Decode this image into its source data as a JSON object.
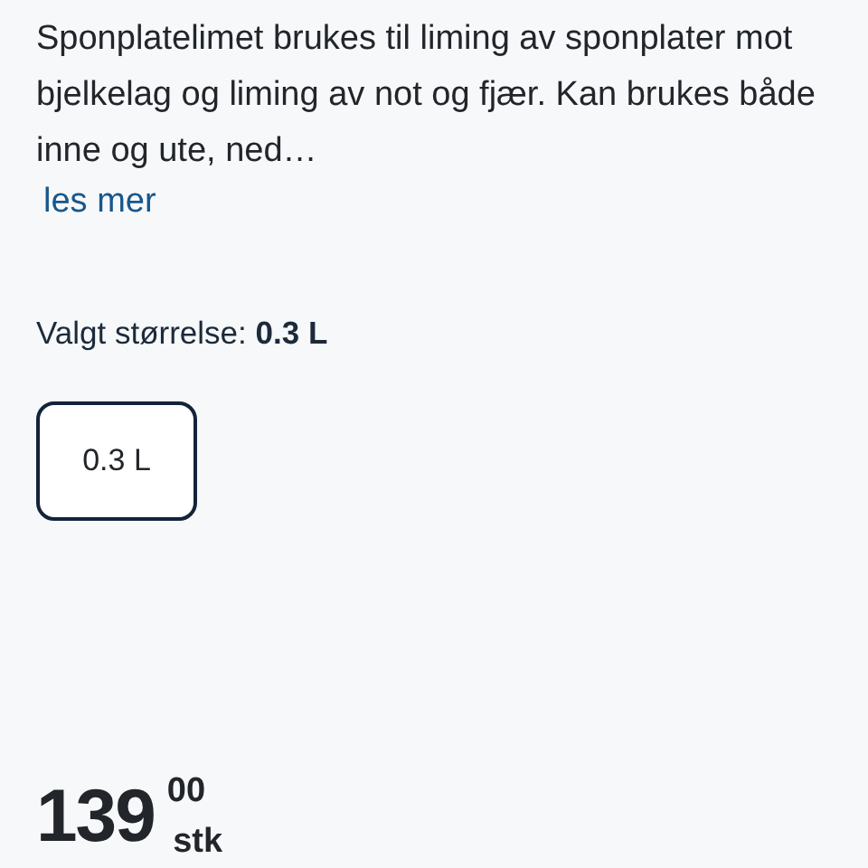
{
  "description": "Sponplatelimet brukes til liming av sponplater mot bjelkelag og liming av not og fjær. Kan brukes både inne og ute, ned…",
  "read_more": "les mer",
  "size_label": "Valgt størrelse: **0.3 L**",
  "sizes": [
    {
      "label": "0.3 L",
      "selected": true
    }
  ],
  "price": {
    "whole": "139",
    "decimals": "00",
    "unit": "stk"
  }
}
